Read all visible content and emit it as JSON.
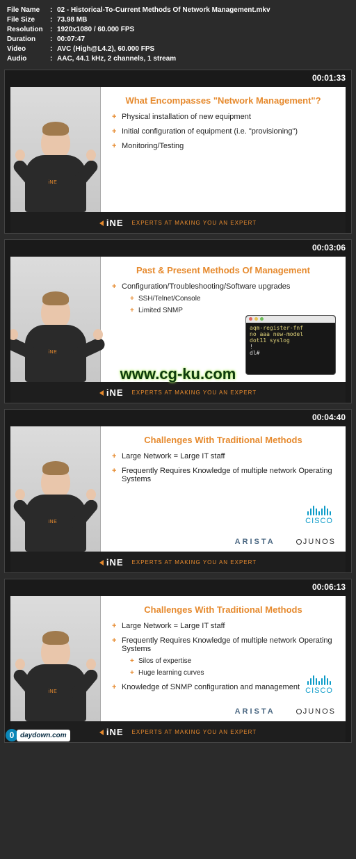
{
  "meta": {
    "labels": {
      "filename": "File Name",
      "filesize": "File Size",
      "resolution": "Resolution",
      "duration": "Duration",
      "video": "Video",
      "audio": "Audio"
    },
    "filename": "02 - Historical-To-Current Methods Of Network Management.mkv",
    "filesize": "73.98 MB",
    "resolution": "1920x1080 / 60.000 FPS",
    "duration": "00:07:47",
    "video": "AVC (High@L4.2), 60.000 FPS",
    "audio": "AAC, 44.1 kHz, 2 channels, 1 stream"
  },
  "ine": {
    "logo": "iNE",
    "tagline": "EXPERTS AT MAKING YOU AN EXPERT",
    "shirt": "iNE"
  },
  "watermarks": {
    "cgku": "www.cg-ku.com",
    "zero": "0",
    "daydown": "daydown.com"
  },
  "frames": [
    {
      "timecode": "00:01:33",
      "arms": "arms-up",
      "slide": {
        "title": "What Encompasses \"Network Management\"?",
        "bullets": [
          {
            "text": "Physical installation of new equipment"
          },
          {
            "text": "Initial configuration of equipment (i.e. \"provisioning\")"
          },
          {
            "text": "Monitoring/Testing"
          }
        ]
      }
    },
    {
      "timecode": "00:03:06",
      "arms": "arms-out",
      "cgku": true,
      "slide": {
        "title": "Past & Present Methods Of Management",
        "bullets": [
          {
            "text": "Configuration/Troubleshooting/Software upgrades",
            "subs": [
              {
                "text": "SSH/Telnet/Console"
              },
              {
                "text": "Limited SNMP"
              }
            ]
          }
        ],
        "terminal": {
          "lines": [
            "aqm-register-fnf",
            "no aaa new-model",
            "dot11 syslog",
            "!",
            "dl#"
          ]
        }
      }
    },
    {
      "timecode": "00:04:40",
      "arms": "arms-up",
      "slide": {
        "title": "Challenges With Traditional Methods",
        "bullets": [
          {
            "text": "Large Network = Large IT staff"
          },
          {
            "text": "Frequently Requires Knowledge of multiple network Operating Systems"
          }
        ],
        "logos": {
          "cisco": "CISCO",
          "arista": "ARISTA",
          "junos": "JUNOS"
        }
      }
    },
    {
      "timecode": "00:06:13",
      "arms": "arms-up",
      "daydown": true,
      "slide": {
        "title": "Challenges With Traditional Methods",
        "bullets": [
          {
            "text": "Large Network = Large IT staff"
          },
          {
            "text": "Frequently Requires Knowledge of multiple network Operating Systems",
            "subs": [
              {
                "text": "Silos of expertise"
              },
              {
                "text": "Huge learning curves"
              }
            ]
          },
          {
            "text": "Knowledge of SNMP configuration and management"
          }
        ],
        "logos": {
          "cisco": "CISCO",
          "arista": "ARISTA",
          "junos": "JUNOS"
        }
      }
    }
  ]
}
